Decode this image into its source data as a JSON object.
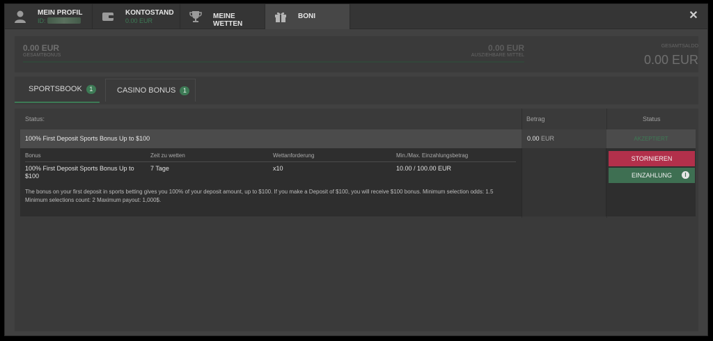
{
  "header": {
    "profile": {
      "title": "MEIN PROFIL",
      "id_label": "ID:"
    },
    "balance": {
      "title": "KONTOSTAND",
      "value": "0.00 EUR"
    },
    "bets": {
      "title": "MEINE WETTEN"
    },
    "boni": {
      "title": "BONI"
    },
    "close_symbol": "✕"
  },
  "summary": {
    "total_bonus_amount": "0.00 EUR",
    "total_bonus_label": "GESAMTBONUS",
    "payable_amount": "0.00 EUR",
    "payable_label": "AUSZIEHBARE MITTEL",
    "progress": 0,
    "total_balance_label": "GESAMTSALDO",
    "total_balance_amount": "0.00 EUR"
  },
  "subtabs": [
    {
      "label": "SPORTSBOOK",
      "count": "1",
      "active": true
    },
    {
      "label": "CASINO BONUS",
      "count": "1",
      "active": false
    }
  ],
  "table": {
    "headers": {
      "status_left": "Status:",
      "amount": "Betrag",
      "status": "Status"
    },
    "row": {
      "name": "100% First Deposit Sports Bonus Up to $100",
      "amount_value": "0.00",
      "amount_currency": "EUR",
      "status": "AKZEPTIERT"
    },
    "detail": {
      "headers": {
        "bonus": "Bonus",
        "time": "Zeit zu wetten",
        "wager": "Wettanforderung",
        "minmax": "Min./Max. Einzahlungsbetrag"
      },
      "values": {
        "bonus_line1": "100% First Deposit Sports Bonus Up to",
        "bonus_line2": "$100",
        "time": "7 Tage",
        "wager": "x10",
        "minmax": "10.00 / 100.00 EUR"
      },
      "description": "The bonus on your first deposit in sports betting gives you 100% of your deposit amount, up to $100. If you make a Deposit of $100, you will receive $100 bonus. Minimum selection odds: 1.5 Minimum selections count: 2 Maximum payout: 1,000$."
    },
    "buttons": {
      "cancel": "STORNIEREN",
      "deposit": "EINZAHLUNG"
    }
  },
  "colors": {
    "accent_green": "#3d7a55",
    "cancel_red": "#b2304b"
  }
}
